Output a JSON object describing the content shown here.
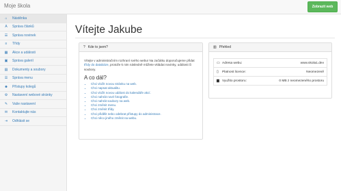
{
  "app": {
    "brand": "Moje škola",
    "view_site_label": "Zobrazit web"
  },
  "sidebar": {
    "items": [
      {
        "label": "Nástěnka",
        "icon": "⌂",
        "icon_name": "home-icon",
        "active": true
      },
      {
        "label": "Správa článků",
        "icon": "A",
        "icon_name": "font-icon"
      },
      {
        "label": "Správa novinek",
        "icon": "☰",
        "icon_name": "news-icon"
      },
      {
        "label": "Třídy",
        "icon": "≡",
        "icon_name": "list-icon"
      },
      {
        "label": "Akce a události",
        "icon": "▦",
        "icon_name": "calendar-icon"
      },
      {
        "label": "Správa galerií",
        "icon": "▣",
        "icon_name": "picture-icon"
      },
      {
        "label": "Dokumenty a soubory",
        "icon": "▤",
        "icon_name": "file-icon"
      },
      {
        "label": "Správa menu",
        "icon": "☰",
        "icon_name": "menu-icon"
      },
      {
        "label": "Přístupy kolegů",
        "icon": "☻",
        "icon_name": "users-icon"
      },
      {
        "label": "Nastavení webové stránky",
        "icon": "⚙",
        "icon_name": "cogs-icon"
      },
      {
        "label": "Vaše nastavení",
        "icon": "✎",
        "icon_name": "user-icon"
      },
      {
        "label": "Kontaktujte nás",
        "icon": "✉",
        "icon_name": "envelope-icon"
      },
      {
        "label": "Odhlásit se",
        "icon": "⇥",
        "icon_name": "logout-icon"
      }
    ]
  },
  "main": {
    "title": "Vítejte Jakube",
    "left_panel": {
      "heading": "Kde to jsem?",
      "heading_icon": "?",
      "intro_before": "Vítejte v administračním rozhraní svého webu! Na začátku doporučujeme přidat ",
      "intro_link": "třídy do databáze",
      "intro_after": ", protože k nim následně můžete vkládat novinky, události či soubory.",
      "subheading": "A co dál?",
      "todo": [
        "Chci vložit novou stránku na web.",
        "Chci napsat aktualitu.",
        "Chci vložit novou událost do kalendáře akcí.",
        "Chci nahrát nové fotografie.",
        "Chci nahrát soubory na web.",
        "Chci změnit menu.",
        "Chci změnit třídy.",
        "Chci přidělit nebo odebrat přístupy do administrace.",
        "Chci něco jiného změnit na webu."
      ]
    },
    "right_panel": {
      "heading": "Přehled",
      "heading_icon": "▥",
      "rows": [
        {
          "icon": "▭",
          "icon_name": "monitor-icon",
          "label": "Adresa webu:",
          "value": "www.skola1.dev"
        },
        {
          "icon": "▯",
          "icon_name": "license-icon",
          "label": "Platnost licence:",
          "value": "Neomezeně"
        },
        {
          "icon": "▆",
          "icon_name": "storage-icon",
          "label": "Využito prostoru:",
          "value": "0 MB z neomezeného prostoru"
        }
      ]
    }
  },
  "colors": {
    "accent": "#337ab7",
    "success": "#5cb85c"
  }
}
